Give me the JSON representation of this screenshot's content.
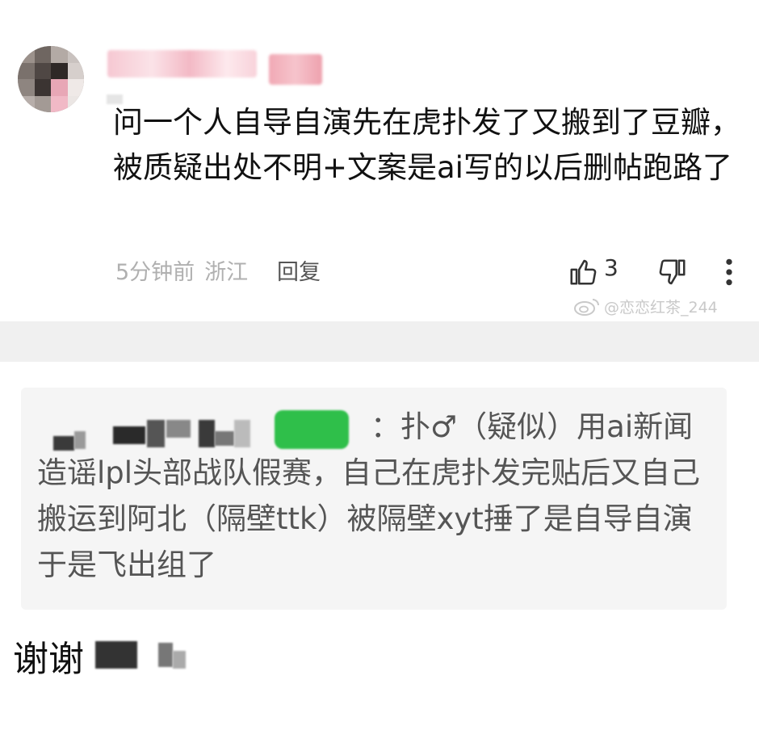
{
  "top_comment": {
    "text": "问一个人自导自演先在虎扑发了又搬到了豆瓣，被质疑出处不明+文案是ai写的以后删帖跑路了",
    "time": "5分钟前",
    "location": "浙江",
    "reply_label": "回复",
    "like_count": "3",
    "watermark": "@恋恋红茶_244"
  },
  "icons": {
    "like": "thumbs-up-icon",
    "dislike": "thumbs-down-icon",
    "more": "more-vertical-icon",
    "weibo": "weibo-logo-icon"
  },
  "quoted_reply": {
    "text": "：扑♂（疑似）用ai新闻造谣lpl头部战队假赛，自己在虎扑发完贴后又自己搬运到阿北（隔壁ttk）被隔壁xyt捶了是自导自演于是飞出组了"
  },
  "bottom": {
    "text": "谢谢"
  },
  "colors": {
    "quote_bg": "#f5f5f5",
    "band_bg": "#f0f0f0",
    "name_pink": "#f6c8d2",
    "green_blur": "#2fbf4a"
  }
}
